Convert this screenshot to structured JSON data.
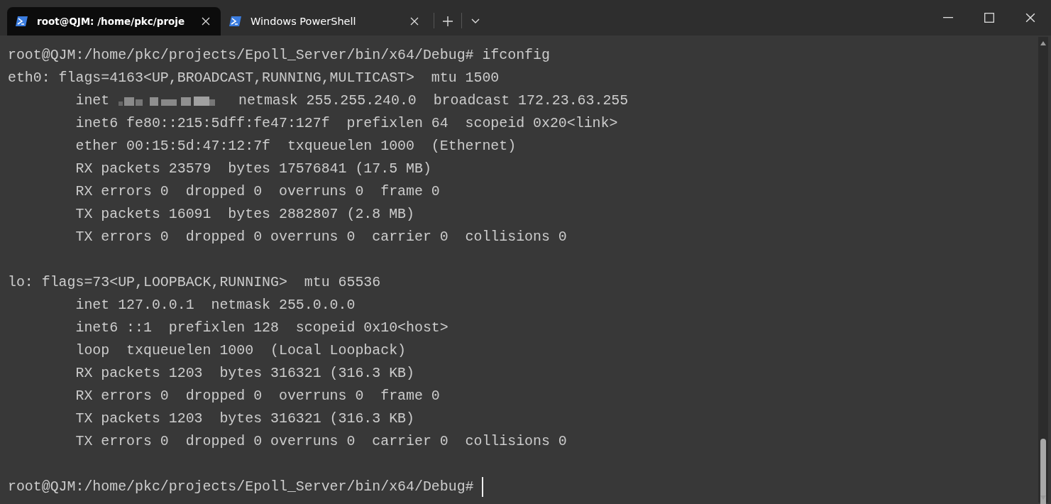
{
  "tabs": [
    {
      "title": "root@QJM: /home/pkc/proje",
      "selected": true
    },
    {
      "title": "Windows PowerShell",
      "selected": false
    }
  ],
  "terminal": {
    "lines": [
      {
        "kind": "text",
        "text": "root@QJM:/home/pkc/projects/Epoll_Server/bin/x64/Debug# ifconfig"
      },
      {
        "kind": "text",
        "text": "eth0: flags=4163<UP,BROADCAST,RUNNING,MULTICAST>  mtu 1500"
      },
      {
        "kind": "redacted",
        "before": "        inet",
        "after": "  netmask 255.255.240.0  broadcast 172.23.63.255"
      },
      {
        "kind": "text",
        "text": "        inet6 fe80::215:5dff:fe47:127f  prefixlen 64  scopeid 0x20<link>"
      },
      {
        "kind": "text",
        "text": "        ether 00:15:5d:47:12:7f  txqueuelen 1000  (Ethernet)"
      },
      {
        "kind": "text",
        "text": "        RX packets 23579  bytes 17576841 (17.5 MB)"
      },
      {
        "kind": "text",
        "text": "        RX errors 0  dropped 0  overruns 0  frame 0"
      },
      {
        "kind": "text",
        "text": "        TX packets 16091  bytes 2882807 (2.8 MB)"
      },
      {
        "kind": "text",
        "text": "        TX errors 0  dropped 0 overruns 0  carrier 0  collisions 0"
      },
      {
        "kind": "blank"
      },
      {
        "kind": "text",
        "text": "lo: flags=73<UP,LOOPBACK,RUNNING>  mtu 65536"
      },
      {
        "kind": "text",
        "text": "        inet 127.0.0.1  netmask 255.0.0.0"
      },
      {
        "kind": "text",
        "text": "        inet6 ::1  prefixlen 128  scopeid 0x10<host>"
      },
      {
        "kind": "text",
        "text": "        loop  txqueuelen 1000  (Local Loopback)"
      },
      {
        "kind": "text",
        "text": "        RX packets 1203  bytes 316321 (316.3 KB)"
      },
      {
        "kind": "text",
        "text": "        RX errors 0  dropped 0  overruns 0  frame 0"
      },
      {
        "kind": "text",
        "text": "        TX packets 1203  bytes 316321 (316.3 KB)"
      },
      {
        "kind": "text",
        "text": "        TX errors 0  dropped 0 overruns 0  carrier 0  collisions 0"
      },
      {
        "kind": "blank"
      },
      {
        "kind": "prompt",
        "text": "root@QJM:/home/pkc/projects/Epoll_Server/bin/x64/Debug# ",
        "cursor": true
      }
    ]
  }
}
